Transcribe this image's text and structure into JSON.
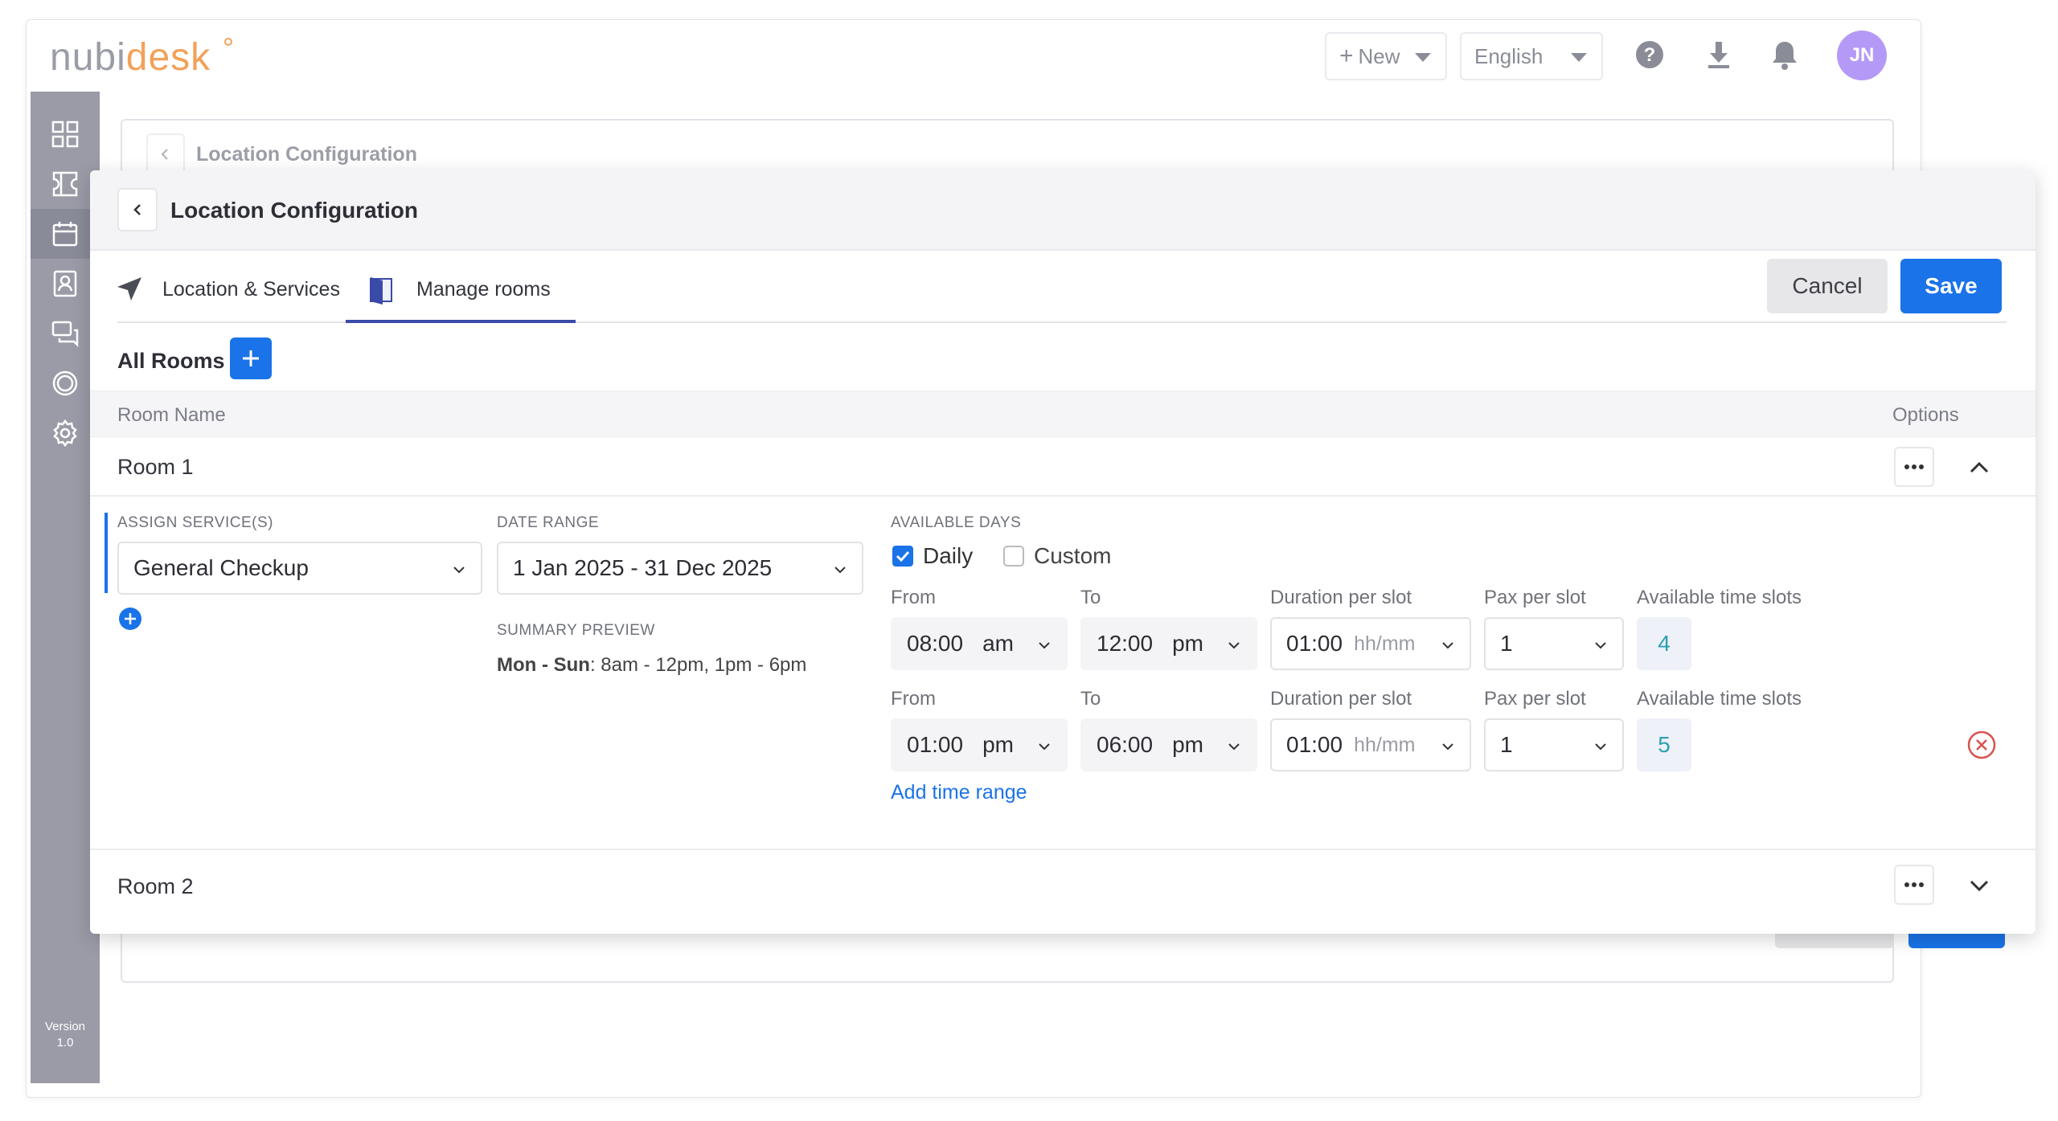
{
  "header": {
    "logo_part1": "nubi",
    "logo_part2": "desk",
    "new_label": "New",
    "language": "English",
    "avatar_initials": "JN",
    "icons": [
      "help-icon",
      "download-icon",
      "bell-icon"
    ]
  },
  "sidebar": {
    "icons": [
      "dashboard-icon",
      "tickets-icon",
      "calendar-icon",
      "contacts-icon",
      "chat-icon",
      "support-icon",
      "settings-icon"
    ],
    "version_label": "Version",
    "version_number": "1.0"
  },
  "background_card": {
    "title": "Location Configuration"
  },
  "modal": {
    "title": "Location Configuration",
    "tabs": [
      {
        "label": "Location & Services",
        "icon": "navigation-icon"
      },
      {
        "label": "Manage rooms",
        "icon": "door-icon"
      }
    ],
    "cancel_label": "Cancel",
    "save_label": "Save",
    "all_rooms_label": "All Rooms",
    "columns": {
      "room_name": "Room Name",
      "options": "Options"
    },
    "rooms": [
      {
        "name": "Room 1",
        "assign_services_label": "ASSIGN SERVICE(S)",
        "service": "General Checkup",
        "date_range_label": "DATE RANGE",
        "date_range": "1 Jan 2025 - 31 Dec 2025",
        "summary_label": "SUMMARY PREVIEW",
        "summary_days": "Mon - Sun",
        "summary_times": ": 8am - 12pm, 1pm - 6pm",
        "available_days_label": "AVAILABLE DAYS",
        "daily_label": "Daily",
        "custom_label": "Custom",
        "labels": {
          "from": "From",
          "to": "To",
          "duration": "Duration per slot",
          "pax": "Pax per slot",
          "available": "Available time slots"
        },
        "duration_unit": "hh/mm",
        "time_ranges": [
          {
            "from_time": "08:00",
            "from_ampm": "am",
            "to_time": "12:00",
            "to_ampm": "pm",
            "duration": "01:00",
            "pax": "1",
            "slots": "4"
          },
          {
            "from_time": "01:00",
            "from_ampm": "pm",
            "to_time": "06:00",
            "to_ampm": "pm",
            "duration": "01:00",
            "pax": "1",
            "slots": "5"
          }
        ],
        "add_time_range_label": "Add time range"
      },
      {
        "name": "Room 2"
      }
    ]
  },
  "colors": {
    "primary": "#1a73e8",
    "sidebar": "#9a9ba7",
    "avatar": "#b49af6",
    "danger": "#d9534f"
  }
}
